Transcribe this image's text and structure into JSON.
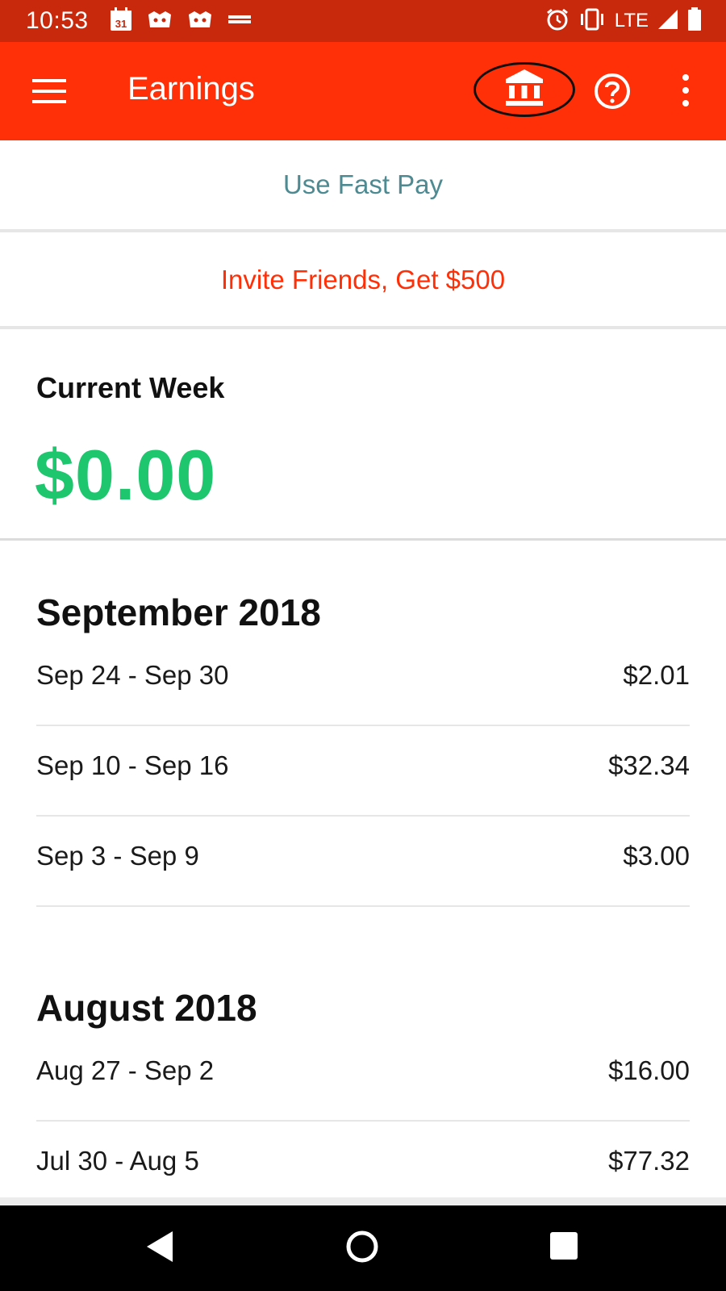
{
  "status_bar": {
    "time": "10:53",
    "calendar_day": "31",
    "network": "LTE",
    "icons": [
      "calendar-icon",
      "crown-icon",
      "crown-icon",
      "notification-icon",
      "alarm-icon",
      "vibrate-icon",
      "signal-icon",
      "battery-icon"
    ]
  },
  "app_bar": {
    "title": "Earnings",
    "icons": [
      "menu-icon",
      "bank-icon",
      "help-icon",
      "overflow-menu-icon"
    ],
    "background_color": "#ff3008"
  },
  "fast_pay_label": "Use Fast Pay",
  "invite_label": "Invite Friends, Get $500",
  "current_week": {
    "label": "Current Week",
    "amount": "$0.00",
    "amount_color": "#1ec66e"
  },
  "months": [
    {
      "heading": "September 2018",
      "rows": [
        {
          "range": "Sep 24 - Sep 30",
          "amount": "$2.01"
        },
        {
          "range": "Sep 10 - Sep 16",
          "amount": "$32.34"
        },
        {
          "range": "Sep 3 - Sep 9",
          "amount": "$3.00"
        }
      ]
    },
    {
      "heading": "August 2018",
      "rows": [
        {
          "range": "Aug 27 - Sep 2",
          "amount": "$16.00"
        },
        {
          "range": "Jul 30 - Aug 5",
          "amount": "$77.32"
        }
      ]
    }
  ],
  "nav_bar": {
    "icons": [
      "back-icon",
      "home-icon",
      "recents-icon"
    ]
  }
}
